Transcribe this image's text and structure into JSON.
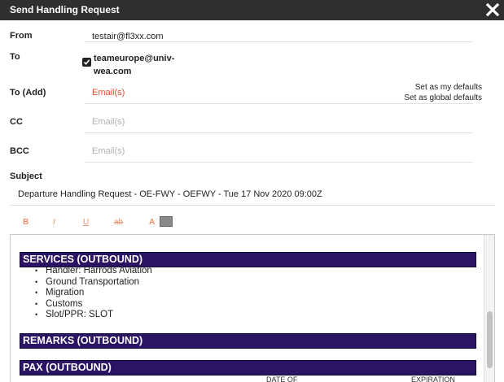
{
  "dialog": {
    "title": "Send Handling Request",
    "close_icon": "close-icon"
  },
  "form": {
    "from_label": "From",
    "from_value": "testair@fl3xx.com",
    "to_label": "To",
    "to_checked": true,
    "to_value": "teameurope@univ-wea.com",
    "to_add_label": "To (Add)",
    "to_add_placeholder": "Email(s)",
    "cc_label": "CC",
    "cc_placeholder": "Email(s)",
    "bcc_label": "BCC",
    "bcc_placeholder": "Email(s)",
    "subject_label": "Subject",
    "subject_value": "Departure Handling Request - OE-FWY - OEFWY - Tue 17 Nov 2020 09:00Z",
    "set_my_defaults": "Set as my defaults",
    "set_global_defaults": "Set as global defaults"
  },
  "toolbar": {
    "bold": "B",
    "italic": "I",
    "underline": "U",
    "strike": "ab",
    "font_color": "A",
    "swatch_color": "#8a8a8a"
  },
  "editor": {
    "services_title": "SERVICES (OUTBOUND)",
    "services": [
      "Handler: Harrods Aviation",
      "Ground Transportation",
      "Migration",
      "Customs",
      "Slot/PPR: SLOT"
    ],
    "remarks_title": "REMARKS (OUTBOUND)",
    "pax_title": "PAX (OUTBOUND)",
    "col_date_of": "DATE OF",
    "col_expiration": "EXPIRATION"
  },
  "colors": {
    "titlebar": "#2f2f2f",
    "section_bar": "#2a1463",
    "email_placeholder_red": "#e8492b",
    "toolbar_accent": "#e8916f"
  }
}
